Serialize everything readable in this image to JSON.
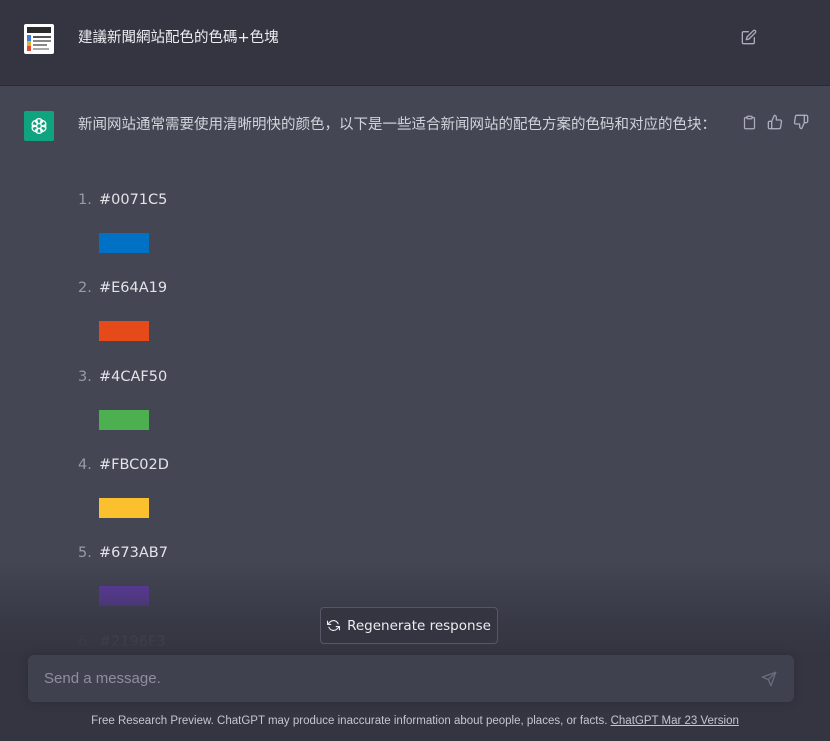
{
  "conversation": {
    "user_message": "建議新聞網站配色的色碼+色塊",
    "assistant": {
      "intro": "新闻网站通常需要使用清晰明快的颜色，以下是一些适合新闻网站的配色方案的色码和对应的色块：",
      "colors": [
        {
          "num": "1.",
          "code": "#0071C5",
          "swatch": "#0071C5"
        },
        {
          "num": "2.",
          "code": "#E64A19",
          "swatch": "#E64A19"
        },
        {
          "num": "3.",
          "code": "#4CAF50",
          "swatch": "#4CAF50"
        },
        {
          "num": "4.",
          "code": "#FBC02D",
          "swatch": "#FBC02D"
        },
        {
          "num": "5.",
          "code": "#673AB7",
          "swatch": "#673AB7"
        },
        {
          "num": "6.",
          "code": "#2196F3",
          "swatch": "#2196F3"
        }
      ]
    }
  },
  "icons": {
    "edit": "edit-icon",
    "copy": "clipboard-icon",
    "like": "thumbs-up-icon",
    "dislike": "thumbs-down-icon",
    "regenerate": "refresh-icon",
    "send": "send-icon",
    "assistant_logo": "openai-logo-icon"
  },
  "regenerate": {
    "label": "Regenerate response"
  },
  "composer": {
    "placeholder": "Send a message."
  },
  "footer": {
    "text": "Free Research Preview. ChatGPT may produce inaccurate information about people, places, or facts. ",
    "link": "ChatGPT Mar 23 Version"
  },
  "theme": {
    "chat_bg": "#343541",
    "assistant_bg": "#444654",
    "accent": "#10a37f"
  }
}
